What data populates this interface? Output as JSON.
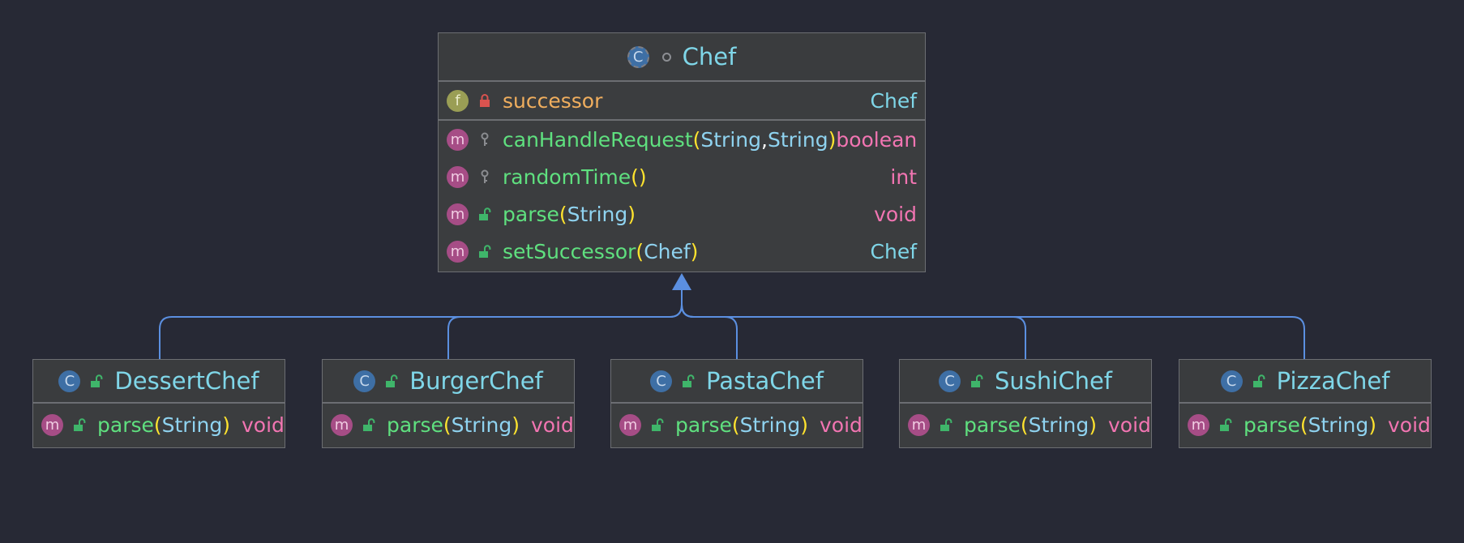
{
  "colors": {
    "background": "#272935",
    "box_fill": "#3b3d3f",
    "box_border": "#6c6e72",
    "connector": "#5b8fe0",
    "class_name": "#7fd6e8",
    "field_name": "#f0ae5e",
    "method_name": "#5fe07f",
    "parenthesis": "#ffe32e",
    "param_type": "#8fd3f0",
    "primitive_type": "#f275b2"
  },
  "parent": {
    "name": "Chef",
    "kind_badge": "C",
    "kind_icon": "abstract-class-icon",
    "fields": [
      {
        "badge": "f",
        "visibility_icon": "private-lock-icon",
        "name": "successor",
        "type": "Chef"
      }
    ],
    "methods": [
      {
        "badge": "m",
        "visibility_icon": "protected-key-icon",
        "name": "canHandleRequest",
        "params": [
          "String",
          "String"
        ],
        "return_type": "boolean"
      },
      {
        "badge": "m",
        "visibility_icon": "protected-key-icon",
        "name": "randomTime",
        "params": [],
        "return_type": "int"
      },
      {
        "badge": "m",
        "visibility_icon": "public-unlock-icon",
        "name": "parse",
        "params": [
          "String"
        ],
        "return_type": "void"
      },
      {
        "badge": "m",
        "visibility_icon": "public-unlock-icon",
        "name": "setSuccessor",
        "params": [
          "Chef"
        ],
        "return_type": "Chef"
      }
    ]
  },
  "children": [
    {
      "name": "DessertChef",
      "kind_badge": "C",
      "method": {
        "badge": "m",
        "name": "parse",
        "param": "String",
        "return_type": "void"
      }
    },
    {
      "name": "BurgerChef",
      "kind_badge": "C",
      "method": {
        "badge": "m",
        "name": "parse",
        "param": "String",
        "return_type": "void"
      }
    },
    {
      "name": "PastaChef",
      "kind_badge": "C",
      "method": {
        "badge": "m",
        "name": "parse",
        "param": "String",
        "return_type": "void"
      }
    },
    {
      "name": "SushiChef",
      "kind_badge": "C",
      "method": {
        "badge": "m",
        "name": "parse",
        "param": "String",
        "return_type": "void"
      }
    },
    {
      "name": "PizzaChef",
      "kind_badge": "C",
      "method": {
        "badge": "m",
        "name": "parse",
        "param": "String",
        "return_type": "void"
      }
    }
  ]
}
